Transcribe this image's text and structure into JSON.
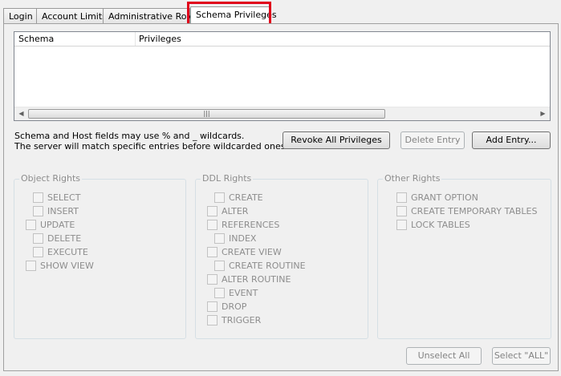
{
  "tabs": [
    {
      "label": "Login"
    },
    {
      "label": "Account Limits"
    },
    {
      "label": "Administrative Roles"
    },
    {
      "label": "Schema Privileges",
      "active": true
    }
  ],
  "grid": {
    "columns": [
      "Schema",
      "Privileges"
    ],
    "scroll_left": "◀",
    "scroll_right": "▶",
    "scroll_grip": "|||"
  },
  "hint": {
    "line1": "Schema and Host fields may use % and _ wildcards.",
    "line2": "The server will match specific entries before wildcarded ones."
  },
  "buttons": {
    "revoke_all": "Revoke All Privileges",
    "delete_entry": "Delete Entry",
    "add_entry": "Add Entry...",
    "unselect_all": "Unselect All",
    "select_all": "Select \"ALL\""
  },
  "object_rights": {
    "title": "Object Rights",
    "items": [
      "SELECT",
      "INSERT",
      "UPDATE",
      "DELETE",
      "EXECUTE",
      "SHOW VIEW"
    ]
  },
  "ddl_rights": {
    "title": "DDL Rights",
    "items": [
      "CREATE",
      "ALTER",
      "REFERENCES",
      "INDEX",
      "CREATE VIEW",
      "CREATE ROUTINE",
      "ALTER ROUTINE",
      "EVENT",
      "DROP",
      "TRIGGER"
    ]
  },
  "other_rights": {
    "title": "Other Rights",
    "items": [
      "GRANT OPTION",
      "CREATE TEMPORARY TABLES",
      "LOCK TABLES"
    ]
  },
  "colors": {
    "highlight": "#e0001b",
    "disabled_text": "#8d8d8d"
  }
}
